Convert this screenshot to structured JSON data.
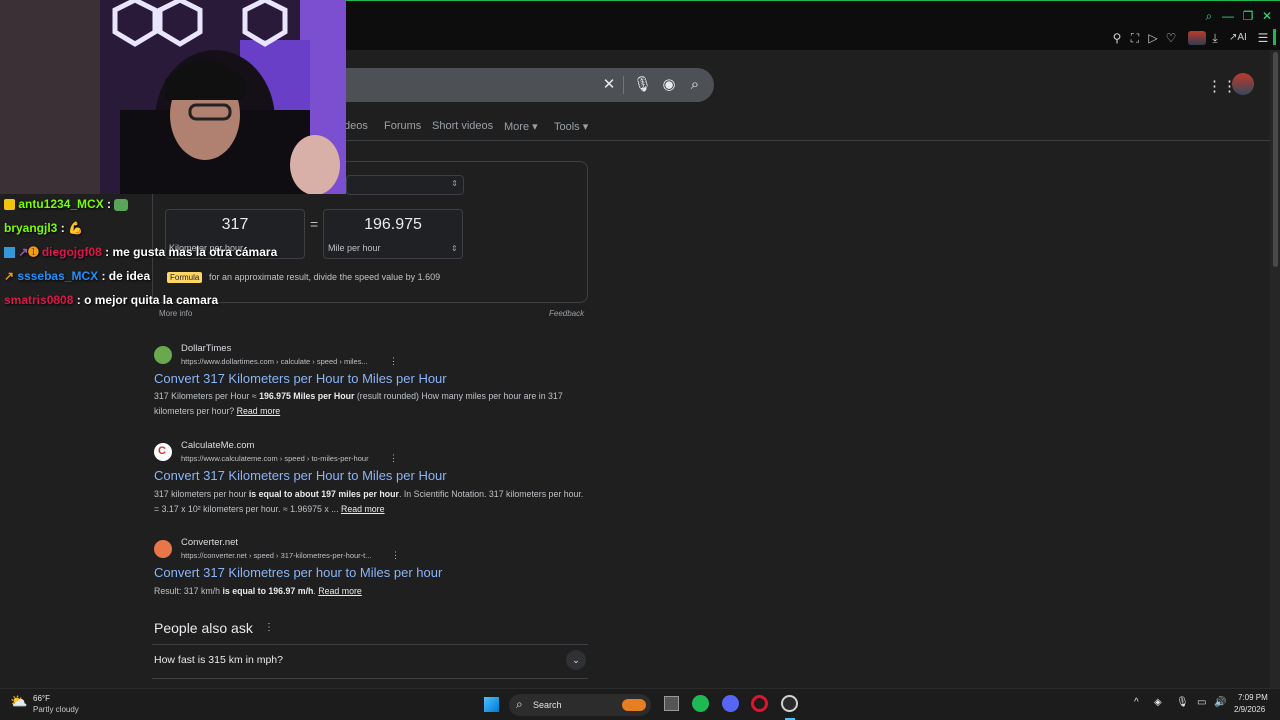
{
  "browser": {
    "toolbar_right_icons": [
      "pin-icon",
      "screenshot-icon",
      "play-icon",
      "heart-icon",
      "avatar",
      "download-icon",
      "ai-icon",
      "menu-icon"
    ],
    "ai_label": "AI"
  },
  "search": {
    "tabs": [
      "deos",
      "Forums",
      "Short videos",
      "More",
      "Tools"
    ]
  },
  "converter": {
    "from_value": "317",
    "to_value": "196.975",
    "from_unit": "Kilometer per hour",
    "to_unit": "Mile per hour",
    "equals": "=",
    "formula_badge": "Formula",
    "formula_text": "for an approximate result, divide the speed value by 1.609",
    "more_info": "More info",
    "feedback": "Feedback"
  },
  "results": [
    {
      "site": "DollarTimes",
      "url": "https://www.dollartimes.com › calculate › speed › miles...",
      "title": "Convert 317 Kilometers per Hour to Miles per Hour",
      "snippet_pre": "317 Kilometers per Hour ≈ ",
      "snippet_bold": "196.975 Miles per Hour",
      "snippet_post": " (result rounded) How many miles per hour are in 317 kilometers per hour? ",
      "read_more": "Read more",
      "favicon_color": "#6aa84f"
    },
    {
      "site": "CalculateMe.com",
      "url": "https://www.calculateme.com › speed › to-miles-per-hour",
      "title": "Convert 317 Kilometers per Hour to Miles per Hour",
      "snippet_pre": "317 kilometers per hour ",
      "snippet_bold": "is equal to about 197 miles per hour",
      "snippet_post": ". In Scientific Notation. 317 kilometers per hour. = 3.17 x 10² kilometers per hour. ≈ 1.96975 x ... ",
      "read_more": "Read more",
      "favicon_color": "#ffffff"
    },
    {
      "site": "Converter.net",
      "url": "https://converter.net › speed › 317-kilometres-per-hour-t...",
      "title": "Convert 317 Kilometres per hour to Miles per hour",
      "snippet_pre": "Result: 317 km/h ",
      "snippet_bold": "is equal to 196.97 m/h",
      "snippet_post": ". ",
      "read_more": "Read more",
      "favicon_color": "#e8764b"
    }
  ],
  "paa": {
    "heading": "People also ask",
    "question": "How fast is 315 km in mph?"
  },
  "chat": [
    {
      "user": "antu1234_MCX",
      "msg": "",
      "color": "#7cfc00"
    },
    {
      "user": "bryangjl3",
      "msg": "",
      "color": "#7cfc00"
    },
    {
      "user": "diegojgf08",
      "msg": "me gusta mas la otra cámara",
      "color": "#e0144c"
    },
    {
      "user": "sssebas_MCX",
      "msg": "de idea",
      "color": "#1e90ff"
    },
    {
      "user": "smatris0808",
      "msg": "o mejor quita la camara",
      "color": "#e0144c"
    }
  ],
  "taskbar": {
    "weather_temp": "66°F",
    "weather_desc": "Partly cloudy",
    "search_label": "Search",
    "time": "7:09 PM",
    "date": "2/9/2026"
  }
}
